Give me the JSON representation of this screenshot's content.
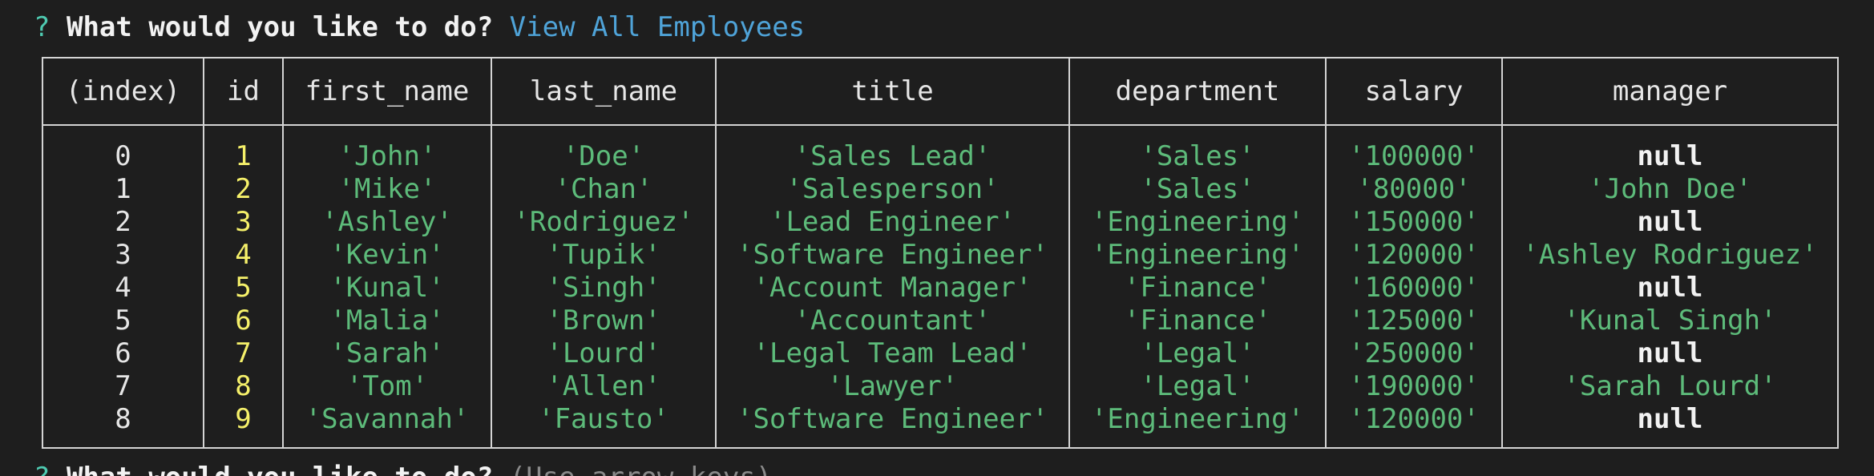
{
  "prompt": {
    "mark": "?",
    "question": "What would you like to do?",
    "answer": "View All Employees"
  },
  "next_prompt": {
    "mark": "?",
    "question": "What would you like to do?",
    "hint": "(Use arrow keys)"
  },
  "table": {
    "columns": [
      "(index)",
      "id",
      "first_name",
      "last_name",
      "title",
      "department",
      "salary",
      "manager"
    ],
    "rows": [
      {
        "index": "0",
        "id": "1",
        "first_name": "'John'",
        "last_name": "'Doe'",
        "title": "'Sales Lead'",
        "department": "'Sales'",
        "salary": "'100000'",
        "manager": "null"
      },
      {
        "index": "1",
        "id": "2",
        "first_name": "'Mike'",
        "last_name": "'Chan'",
        "title": "'Salesperson'",
        "department": "'Sales'",
        "salary": "'80000'",
        "manager": "'John Doe'"
      },
      {
        "index": "2",
        "id": "3",
        "first_name": "'Ashley'",
        "last_name": "'Rodriguez'",
        "title": "'Lead Engineer'",
        "department": "'Engineering'",
        "salary": "'150000'",
        "manager": "null"
      },
      {
        "index": "3",
        "id": "4",
        "first_name": "'Kevin'",
        "last_name": "'Tupik'",
        "title": "'Software Engineer'",
        "department": "'Engineering'",
        "salary": "'120000'",
        "manager": "'Ashley Rodriguez'"
      },
      {
        "index": "4",
        "id": "5",
        "first_name": "'Kunal'",
        "last_name": "'Singh'",
        "title": "'Account Manager'",
        "department": "'Finance'",
        "salary": "'160000'",
        "manager": "null"
      },
      {
        "index": "5",
        "id": "6",
        "first_name": "'Malia'",
        "last_name": "'Brown'",
        "title": "'Accountant'",
        "department": "'Finance'",
        "salary": "'125000'",
        "manager": "'Kunal Singh'"
      },
      {
        "index": "6",
        "id": "7",
        "first_name": "'Sarah'",
        "last_name": "'Lourd'",
        "title": "'Legal Team Lead'",
        "department": "'Legal'",
        "salary": "'250000'",
        "manager": "null"
      },
      {
        "index": "7",
        "id": "8",
        "first_name": "'Tom'",
        "last_name": "'Allen'",
        "title": "'Lawyer'",
        "department": "'Legal'",
        "salary": "'190000'",
        "manager": "'Sarah Lourd'"
      },
      {
        "index": "8",
        "id": "9",
        "first_name": "'Savannah'",
        "last_name": "'Fausto'",
        "title": "'Software Engineer'",
        "department": "'Engineering'",
        "salary": "'120000'",
        "manager": "null"
      }
    ]
  },
  "colors": {
    "background": "#1e1e1e",
    "prompt_mark": "#4ec9b0",
    "answer": "#4fa3d8",
    "number": "#f5f06a",
    "string": "#5dbb7a",
    "border": "#d4d4d4"
  }
}
